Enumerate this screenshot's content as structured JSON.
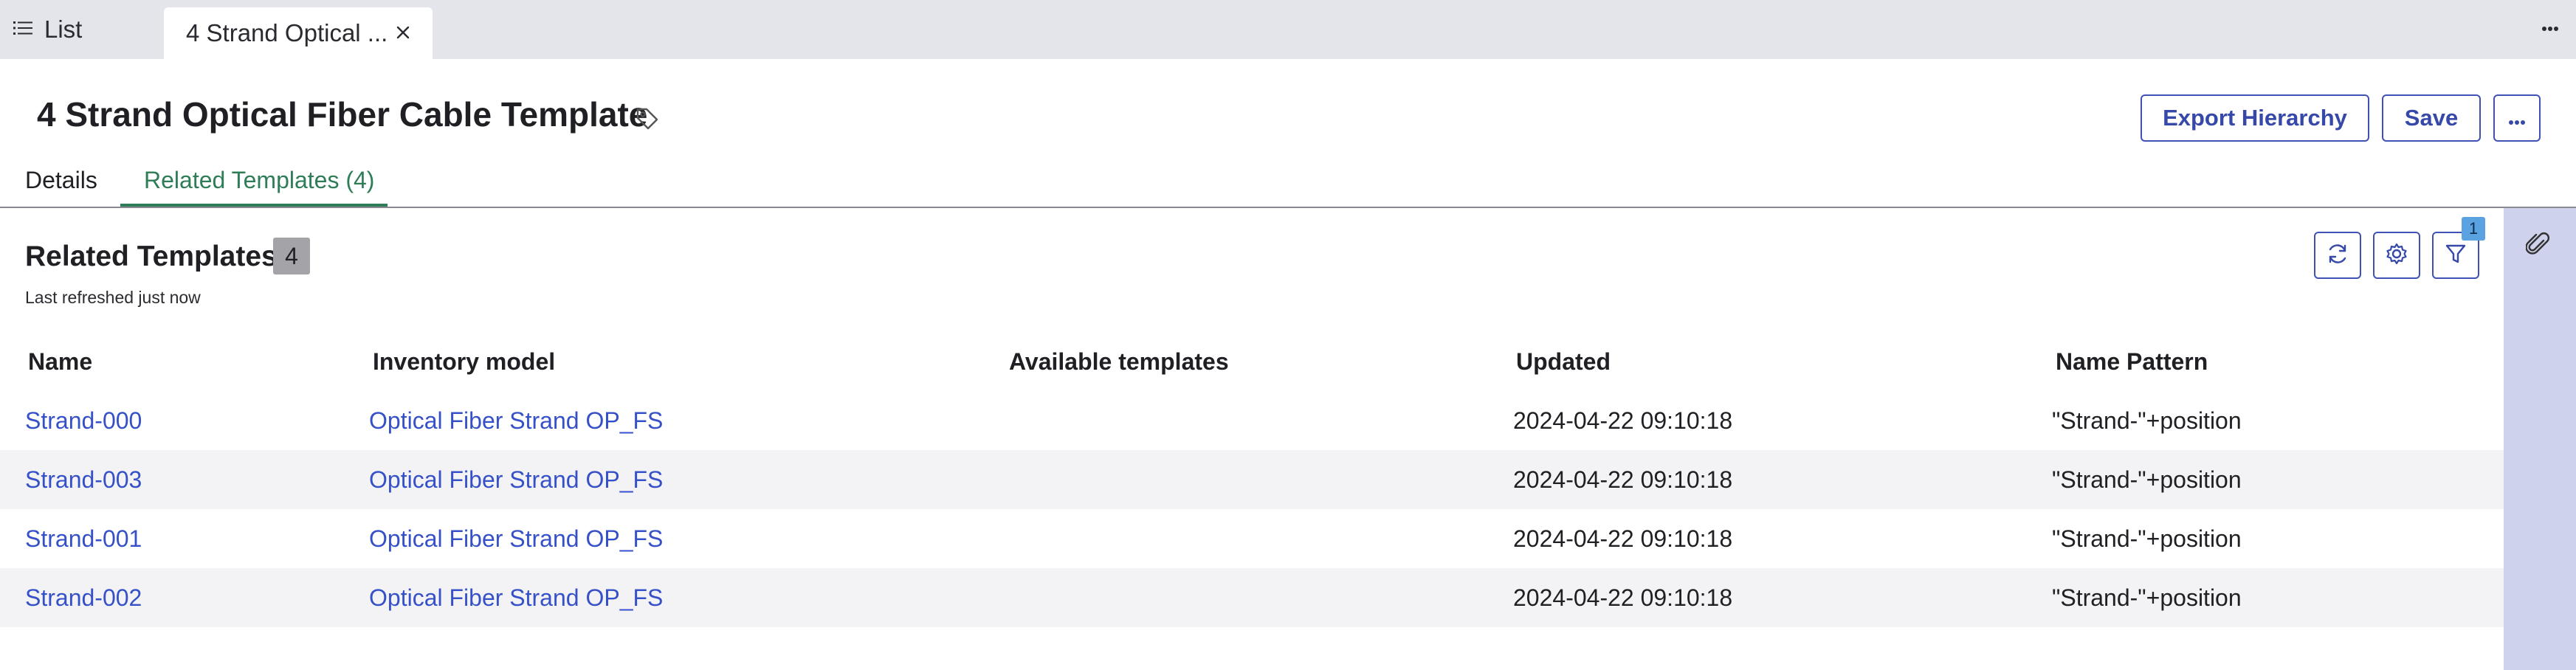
{
  "tabs": {
    "list_label": "List",
    "active_label": "4 Strand Optical ..."
  },
  "header": {
    "title": "4 Strand Optical Fiber Cable Template",
    "export_label": "Export Hierarchy",
    "save_label": "Save"
  },
  "subtabs": {
    "details": "Details",
    "related": "Related Templates (4)"
  },
  "section": {
    "title": "Related Templates",
    "count": "4",
    "refreshed": "Last refreshed just now",
    "filter_count": "1"
  },
  "table": {
    "columns": [
      "Name",
      "Inventory model",
      "Available templates",
      "Updated",
      "Name Pattern"
    ],
    "rows": [
      {
        "name": "Strand-000",
        "model": "Optical Fiber Strand OP_FS",
        "available": "",
        "updated": "2024-04-22 09:10:18",
        "pattern": "\"Strand-\"+position"
      },
      {
        "name": "Strand-003",
        "model": "Optical Fiber Strand OP_FS",
        "available": "",
        "updated": "2024-04-22 09:10:18",
        "pattern": "\"Strand-\"+position"
      },
      {
        "name": "Strand-001",
        "model": "Optical Fiber Strand OP_FS",
        "available": "",
        "updated": "2024-04-22 09:10:18",
        "pattern": "\"Strand-\"+position"
      },
      {
        "name": "Strand-002",
        "model": "Optical Fiber Strand OP_FS",
        "available": "",
        "updated": "2024-04-22 09:10:18",
        "pattern": "\"Strand-\"+position"
      }
    ]
  },
  "colors": {
    "accent": "#3f51b5",
    "link": "#3651c8",
    "active_tab": "#2e7d57",
    "rail": "#cfd2ec"
  },
  "icons": [
    "list-icon",
    "close-icon",
    "more-horizontal-icon",
    "tag-icon",
    "refresh-icon",
    "gear-icon",
    "filter-icon",
    "paperclip-icon"
  ]
}
